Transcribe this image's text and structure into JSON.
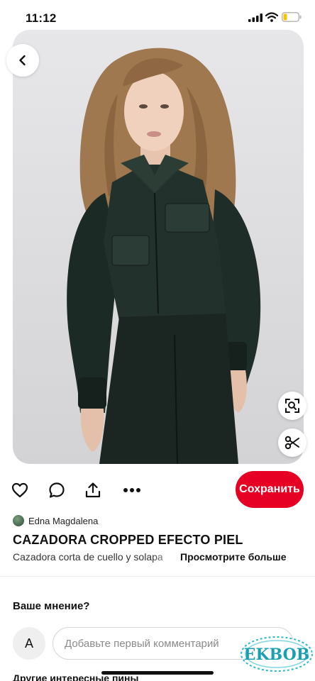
{
  "status_bar": {
    "time": "11:12"
  },
  "pin": {
    "title": "CAZADORA CROPPED EFECTO PIEL",
    "description": "Cazadora corta de cuello y solapa",
    "see_more": "Просмотрите больше",
    "image_icons": [
      "back-arrow-icon",
      "visual-search-icon",
      "scissors-icon"
    ]
  },
  "actions": {
    "icons": [
      "heart-icon",
      "comment-bubble-icon",
      "share-icon",
      "more-dots-icon"
    ],
    "save_label": "Сохранить",
    "accent_color": "#e60023"
  },
  "author": {
    "name": "Edna Magdalena"
  },
  "comments": {
    "heading": "Ваше мнение?",
    "avatar_initial": "A",
    "placeholder": "Добавьте первый комментарий"
  },
  "more_pins": {
    "title": "Другие интересные пины"
  },
  "watermark": {
    "text": "EKBOB"
  }
}
